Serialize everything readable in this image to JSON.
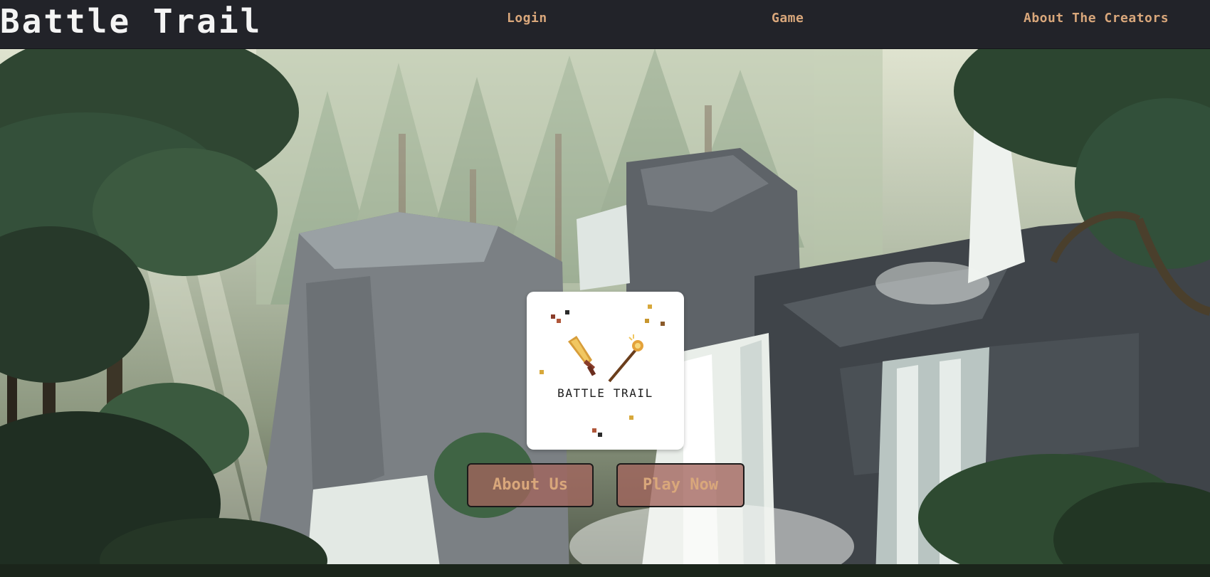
{
  "navbar": {
    "brand": "Battle Trail",
    "links": {
      "login": "Login",
      "game": "Game",
      "about_creators": "About The Creators"
    }
  },
  "hero": {
    "logo": {
      "text": "BATTLE TRAIL",
      "icons": [
        "sword-icon",
        "staff-icon"
      ]
    },
    "buttons": {
      "about_us": "About Us",
      "play_now": "Play Now"
    }
  },
  "colors": {
    "navbar_bg": "#222329",
    "brand_text": "#f4f4f4",
    "nav_link": "#d9a77b",
    "button_bg": "#a1645c",
    "button_text": "#d9a77b"
  }
}
